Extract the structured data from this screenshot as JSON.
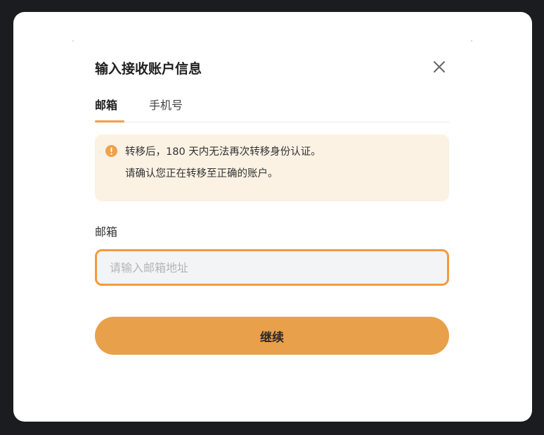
{
  "dialog": {
    "title": "输入接收账户信息",
    "close_icon": "close-icon"
  },
  "tabs": [
    {
      "label": "邮箱",
      "active": true
    },
    {
      "label": "手机号",
      "active": false
    }
  ],
  "notice": {
    "icon": "warning-circle-icon",
    "icon_color": "#f0a14b",
    "line1": "转移后，180 天内无法再次转移身份认证。",
    "line2": "请确认您正在转移至正确的账户。"
  },
  "form": {
    "email_label": "邮箱",
    "email_placeholder": "请输入邮箱地址",
    "email_value": ""
  },
  "actions": {
    "continue_label": "继续"
  },
  "colors": {
    "accent": "#e9a04a",
    "input_focus_border": "#f59a3c",
    "notice_bg": "#fbf2e4"
  }
}
